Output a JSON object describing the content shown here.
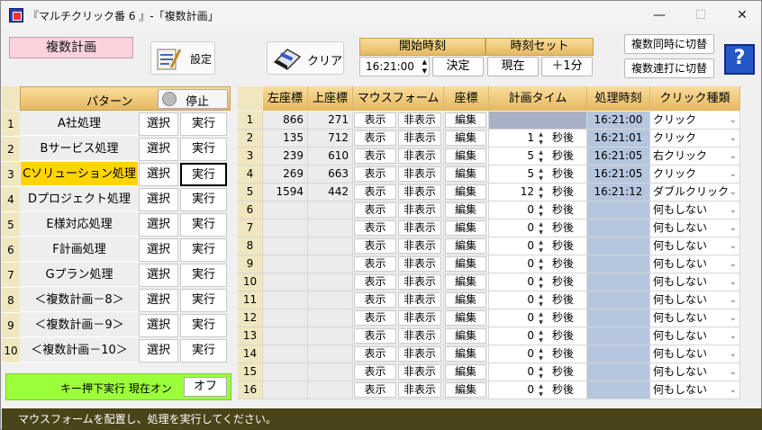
{
  "window": {
    "title": "『マルチクリック番 6 』-「複数計画」"
  },
  "header": {
    "plan_tag": "複数計画",
    "settings_label": "設定",
    "clear_label": "クリア",
    "start_time_header": "開始時刻",
    "time_set_header": "時刻セット",
    "start_time_value": "16:21:00",
    "decide_label": "決定",
    "now_label": "現在",
    "plus_minute_label": "＋1分",
    "simul_toggle": "複数同時に切替",
    "serial_toggle": "複数連打に切替",
    "help_label": "?"
  },
  "patterns": {
    "header": "パターン",
    "stop_label": "停止",
    "select_label": "選択",
    "run_label": "実行",
    "items": [
      {
        "no": "1",
        "name": "A社処理"
      },
      {
        "no": "2",
        "name": "Bサービス処理"
      },
      {
        "no": "3",
        "name": "Cソリューション処理"
      },
      {
        "no": "4",
        "name": "Dプロジェクト処理"
      },
      {
        "no": "5",
        "name": "E様対応処理"
      },
      {
        "no": "6",
        "name": "F計画処理"
      },
      {
        "no": "7",
        "name": "Gプラン処理"
      },
      {
        "no": "8",
        "name": "＜複数計画－8＞"
      },
      {
        "no": "9",
        "name": "＜複数計画－9＞"
      },
      {
        "no": "10",
        "name": "＜複数計画－10＞"
      }
    ]
  },
  "keybar": {
    "label": "キー押下実行 現在オン",
    "toggle": "オフ"
  },
  "grid": {
    "headers": [
      "左座標",
      "上座標",
      "マウスフォーム",
      "座標",
      "計画タイム",
      "処理時刻",
      "クリック種類"
    ],
    "show_label": "表示",
    "hide_label": "非表示",
    "edit_label": "編集",
    "after_label": "秒後",
    "rows": [
      {
        "no": "1",
        "x": "866",
        "y": "271",
        "delay": "",
        "time": "16:21:00",
        "click": "クリック"
      },
      {
        "no": "2",
        "x": "135",
        "y": "712",
        "delay": "1",
        "time": "16:21:01",
        "click": "クリック"
      },
      {
        "no": "3",
        "x": "239",
        "y": "610",
        "delay": "5",
        "time": "16:21:05",
        "click": "右クリック"
      },
      {
        "no": "4",
        "x": "269",
        "y": "663",
        "delay": "5",
        "time": "16:21:05",
        "click": "クリック"
      },
      {
        "no": "5",
        "x": "1594",
        "y": "442",
        "delay": "12",
        "time": "16:21:12",
        "click": "ダブルクリック"
      },
      {
        "no": "6",
        "x": "",
        "y": "",
        "delay": "0",
        "time": "",
        "click": "何もしない"
      },
      {
        "no": "7",
        "x": "",
        "y": "",
        "delay": "0",
        "time": "",
        "click": "何もしない"
      },
      {
        "no": "8",
        "x": "",
        "y": "",
        "delay": "0",
        "time": "",
        "click": "何もしない"
      },
      {
        "no": "9",
        "x": "",
        "y": "",
        "delay": "0",
        "time": "",
        "click": "何もしない"
      },
      {
        "no": "10",
        "x": "",
        "y": "",
        "delay": "0",
        "time": "",
        "click": "何もしない"
      },
      {
        "no": "11",
        "x": "",
        "y": "",
        "delay": "0",
        "time": "",
        "click": "何もしない"
      },
      {
        "no": "12",
        "x": "",
        "y": "",
        "delay": "0",
        "time": "",
        "click": "何もしない"
      },
      {
        "no": "13",
        "x": "",
        "y": "",
        "delay": "0",
        "time": "",
        "click": "何もしない"
      },
      {
        "no": "14",
        "x": "",
        "y": "",
        "delay": "0",
        "time": "",
        "click": "何もしない"
      },
      {
        "no": "15",
        "x": "",
        "y": "",
        "delay": "0",
        "time": "",
        "click": "何もしない"
      },
      {
        "no": "16",
        "x": "",
        "y": "",
        "delay": "0",
        "time": "",
        "click": "何もしない"
      }
    ]
  },
  "status": {
    "message": "マウスフォームを配置し、処理を実行してください。"
  }
}
